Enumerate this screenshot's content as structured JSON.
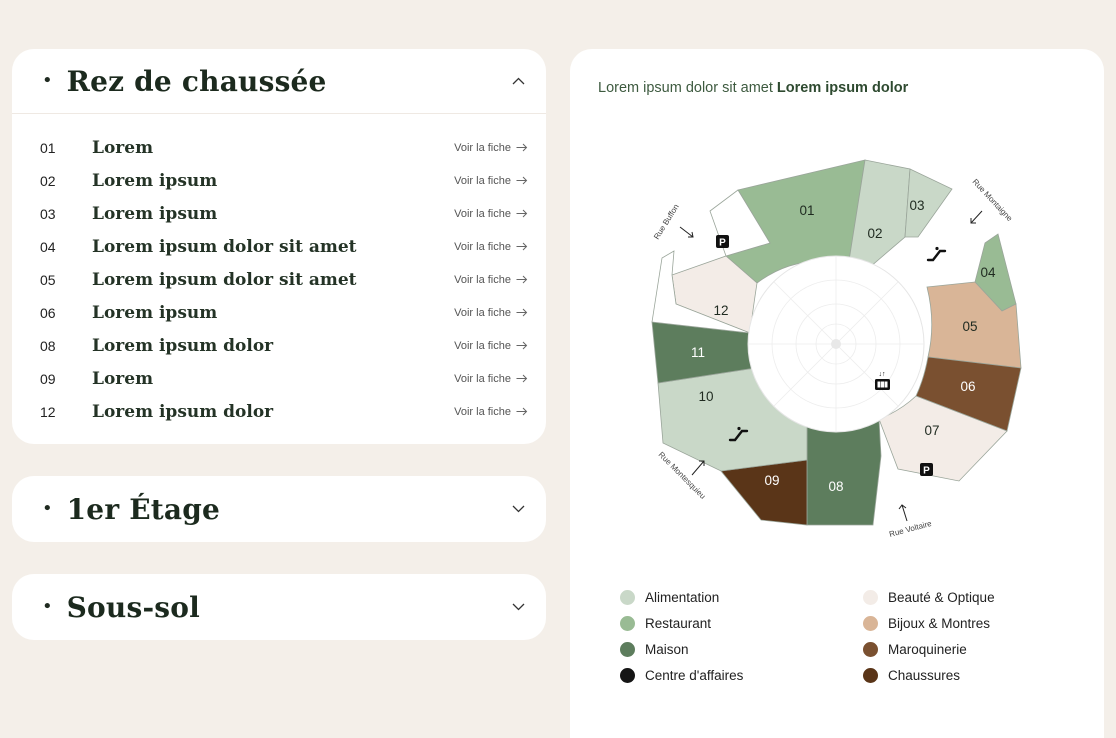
{
  "sections": [
    {
      "title": "Rez de chaussée",
      "expanded": true,
      "link_label": "Voir la fiche",
      "items": [
        {
          "num": "01",
          "name": "Lorem"
        },
        {
          "num": "02",
          "name": "Lorem ipsum"
        },
        {
          "num": "03",
          "name": "Lorem ipsum"
        },
        {
          "num": "04",
          "name": "Lorem ipsum dolor sit amet"
        },
        {
          "num": "05",
          "name": "Lorem ipsum dolor sit amet"
        },
        {
          "num": "06",
          "name": "Lorem ipsum"
        },
        {
          "num": "08",
          "name": "Lorem ipsum dolor"
        },
        {
          "num": "09",
          "name": "Lorem"
        },
        {
          "num": "12",
          "name": "Lorem ipsum dolor"
        }
      ]
    },
    {
      "title": "1er Étage",
      "expanded": false
    },
    {
      "title": "Sous-sol",
      "expanded": false
    }
  ],
  "map": {
    "heading_regular": "Lorem ipsum dolor sit amet",
    "heading_bold": "Lorem ipsum dolor",
    "zones": [
      "01",
      "02",
      "03",
      "04",
      "05",
      "06",
      "07",
      "08",
      "09",
      "10",
      "11",
      "12"
    ],
    "streets": [
      "Rue Buffon",
      "Rue Montaigne",
      "Rue Montesquieu",
      "Rue Voltaire"
    ],
    "parking_label": "P"
  },
  "legend": [
    {
      "label": "Alimentation",
      "color": "#c9d8c8"
    },
    {
      "label": "Beauté & Optique",
      "color": "#f3ece7"
    },
    {
      "label": "Restaurant",
      "color": "#99bb94"
    },
    {
      "label": "Bijoux & Montres",
      "color": "#d9b597"
    },
    {
      "label": "Maison",
      "color": "#5d7d5d"
    },
    {
      "label": "Maroquinerie",
      "color": "#7a5030"
    },
    {
      "label": "Centre d'affaires",
      "color": "#151515"
    },
    {
      "label": "Chaussures",
      "color": "#5a3518"
    }
  ]
}
